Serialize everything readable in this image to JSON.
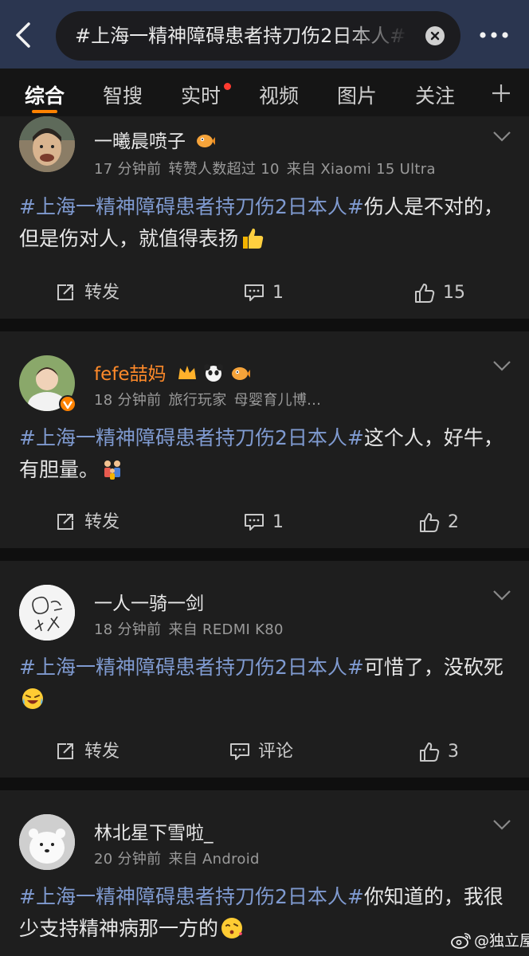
{
  "header": {
    "search_query": "#上海一精神障碍患者持刀伤2日本人#"
  },
  "tabs": [
    {
      "label": "综合"
    },
    {
      "label": "智搜"
    },
    {
      "label": "实时"
    },
    {
      "label": "视频"
    },
    {
      "label": "图片"
    },
    {
      "label": "关注"
    }
  ],
  "posts": [
    {
      "username": "一曦晨喷子",
      "time": "17 分钟前",
      "meta1": "转赞人数超过 10",
      "meta2": "来自 Xiaomi 15 Ultra",
      "hashtag": "#上海一精神障碍患者持刀伤2日本人#",
      "text": "伤人是不对的，但是伤对人，就值得表扬",
      "repost_label": "转发",
      "comment_label": "1",
      "like_count": "15"
    },
    {
      "username": "fefe喆妈",
      "time": "18 分钟前",
      "meta1": "旅行玩家",
      "meta2": "母婴育儿博...",
      "hashtag": "#上海一精神障碍患者持刀伤2日本人#",
      "text": "这个人，好牛，有胆量。",
      "repost_label": "转发",
      "comment_label": "1",
      "like_count": "2"
    },
    {
      "username": "一人一骑一剑",
      "time": "18 分钟前",
      "meta1": "来自 REDMI K80",
      "meta2": "",
      "hashtag": "#上海一精神障碍患者持刀伤2日本人#",
      "text": "可惜了，没砍死",
      "repost_label": "转发",
      "comment_label": "评论",
      "like_count": "3"
    },
    {
      "username": "林北星下雪啦_",
      "time": "20 分钟前",
      "meta1": "来自 Android",
      "meta2": "",
      "hashtag": "#上海一精神障碍患者持刀伤2日本人#",
      "text": "你知道的，我很少支持精神病那一方的"
    }
  ],
  "watermark": "@独立屋",
  "colors": {
    "header_bg": "#2b3650",
    "hashtag": "#7f9ad0",
    "tab_underline": "#ff8200",
    "vip_name": "#ff8a2a",
    "notification_dot": "#ff3b30"
  }
}
